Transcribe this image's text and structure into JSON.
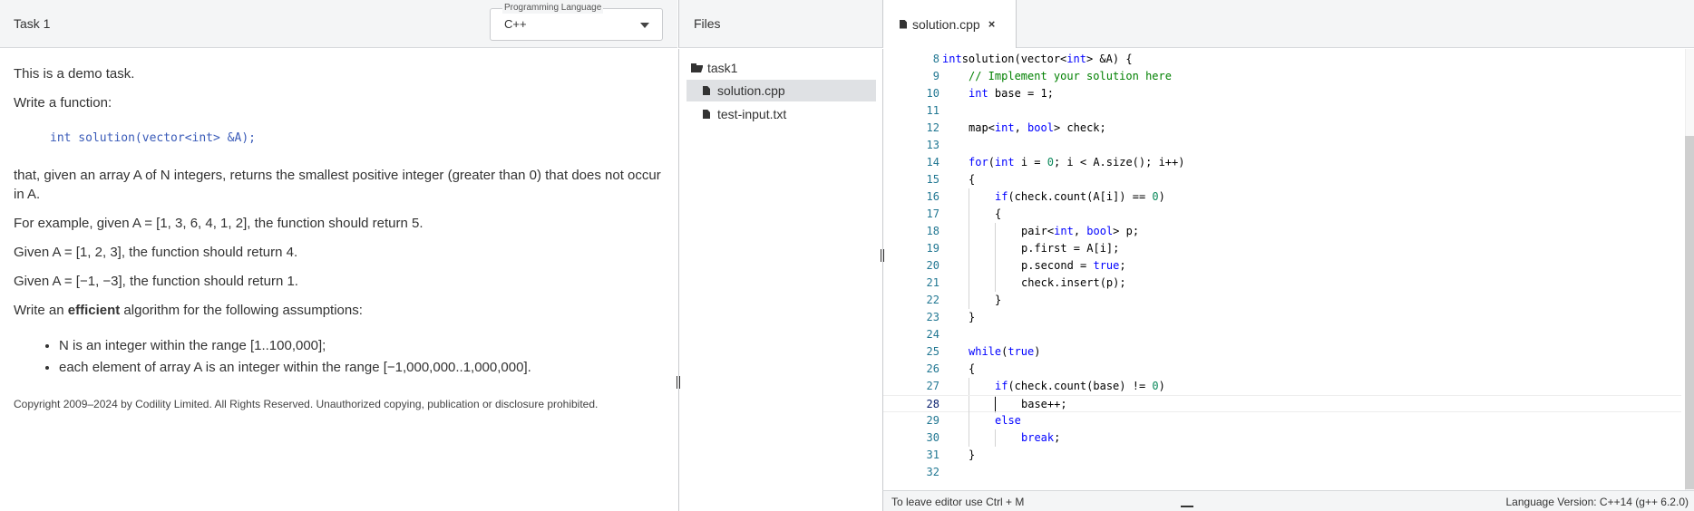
{
  "task": {
    "title": "Task 1",
    "language_label": "Programming Language",
    "language_value": "C++",
    "paragraphs": [
      "This is a demo task.",
      "Write a function:"
    ],
    "signature": "int solution(vector<int> &A);",
    "desc1": "that, given an array A of N integers, returns the smallest positive integer (greater than 0) that does not occur in A.",
    "example1": "For example, given A = [1, 3, 6, 4, 1, 2], the function should return 5.",
    "example2": "Given A = [1, 2, 3], the function should return 4.",
    "example3": "Given A = [−1, −3], the function should return 1.",
    "assume_prefix": "Write an ",
    "assume_bold": "efficient",
    "assume_suffix": " algorithm for the following assumptions:",
    "assumptions": [
      "N is an integer within the range [1..100,000];",
      "each element of array A is an integer within the range [−1,000,000..1,000,000]."
    ],
    "copyright": "Copyright 2009–2024 by Codility Limited. All Rights Reserved. Unauthorized copying, publication or disclosure prohibited."
  },
  "files": {
    "title": "Files",
    "folder": "task1",
    "items": [
      "solution.cpp",
      "test-input.txt"
    ],
    "selected": "solution.cpp"
  },
  "editor": {
    "tab_label": "solution.cpp",
    "tab_close": "×",
    "current_line": 28,
    "lines": [
      {
        "n": 8,
        "indent": 0,
        "tokens": [
          [
            "kw",
            "int"
          ],
          [
            "",
            "solution(vector<"
          ],
          [
            "kw",
            "int"
          ],
          [
            "",
            "> &A) {"
          ]
        ]
      },
      {
        "n": 9,
        "indent": 1,
        "tokens": [
          [
            "cm",
            "// Implement your solution here"
          ]
        ]
      },
      {
        "n": 10,
        "indent": 1,
        "tokens": [
          [
            "kw",
            "int"
          ],
          [
            "",
            " base = 1;"
          ]
        ]
      },
      {
        "n": 11,
        "indent": 0,
        "tokens": []
      },
      {
        "n": 12,
        "indent": 1,
        "tokens": [
          [
            "",
            "map<"
          ],
          [
            "kw",
            "int"
          ],
          [
            "",
            ", "
          ],
          [
            "kw",
            "bool"
          ],
          [
            "",
            "> check;"
          ]
        ]
      },
      {
        "n": 13,
        "indent": 0,
        "tokens": []
      },
      {
        "n": 14,
        "indent": 1,
        "tokens": [
          [
            "kw",
            "for"
          ],
          [
            "",
            "("
          ],
          [
            "kw",
            "int"
          ],
          [
            "",
            " i = "
          ],
          [
            "nm",
            "0"
          ],
          [
            "",
            "; i < A.size(); i++)"
          ]
        ]
      },
      {
        "n": 15,
        "indent": 1,
        "tokens": [
          [
            "",
            "{"
          ]
        ]
      },
      {
        "n": 16,
        "indent": 2,
        "tokens": [
          [
            "kw",
            "if"
          ],
          [
            "",
            "(check.count(A[i]) == "
          ],
          [
            "nm",
            "0"
          ],
          [
            "",
            ")"
          ]
        ]
      },
      {
        "n": 17,
        "indent": 2,
        "tokens": [
          [
            "",
            "{"
          ]
        ]
      },
      {
        "n": 18,
        "indent": 3,
        "tokens": [
          [
            "",
            "pair<"
          ],
          [
            "kw",
            "int"
          ],
          [
            "",
            ", "
          ],
          [
            "kw",
            "bool"
          ],
          [
            "",
            "> p;"
          ]
        ]
      },
      {
        "n": 19,
        "indent": 3,
        "tokens": [
          [
            "",
            "p.first = A[i];"
          ]
        ]
      },
      {
        "n": 20,
        "indent": 3,
        "tokens": [
          [
            "",
            "p.second = "
          ],
          [
            "kw",
            "true"
          ],
          [
            "",
            ";"
          ]
        ]
      },
      {
        "n": 21,
        "indent": 3,
        "tokens": [
          [
            "",
            "check.insert(p);"
          ]
        ]
      },
      {
        "n": 22,
        "indent": 2,
        "tokens": [
          [
            "",
            "}"
          ]
        ]
      },
      {
        "n": 23,
        "indent": 1,
        "tokens": [
          [
            "",
            "}"
          ]
        ]
      },
      {
        "n": 24,
        "indent": 0,
        "tokens": []
      },
      {
        "n": 25,
        "indent": 1,
        "tokens": [
          [
            "kw",
            "while"
          ],
          [
            "",
            "("
          ],
          [
            "kw",
            "true"
          ],
          [
            "",
            ")"
          ]
        ]
      },
      {
        "n": 26,
        "indent": 1,
        "tokens": [
          [
            "",
            "{"
          ]
        ]
      },
      {
        "n": 27,
        "indent": 2,
        "tokens": [
          [
            "kw",
            "if"
          ],
          [
            "",
            "(check.count(base) != "
          ],
          [
            "nm",
            "0"
          ],
          [
            "",
            ")"
          ]
        ]
      },
      {
        "n": 28,
        "indent": 3,
        "tokens": [
          [
            "",
            "base++;"
          ]
        ]
      },
      {
        "n": 29,
        "indent": 2,
        "tokens": [
          [
            "kw",
            "else"
          ]
        ]
      },
      {
        "n": 30,
        "indent": 3,
        "tokens": [
          [
            "kw",
            "break"
          ],
          [
            "",
            ";"
          ]
        ]
      },
      {
        "n": 31,
        "indent": 1,
        "tokens": [
          [
            "",
            "}"
          ]
        ]
      },
      {
        "n": 32,
        "indent": 0,
        "tokens": []
      }
    ]
  },
  "status": {
    "left": "To leave editor use Ctrl + M",
    "right": "Language Version: C++14 (g++ 6.2.0)"
  }
}
